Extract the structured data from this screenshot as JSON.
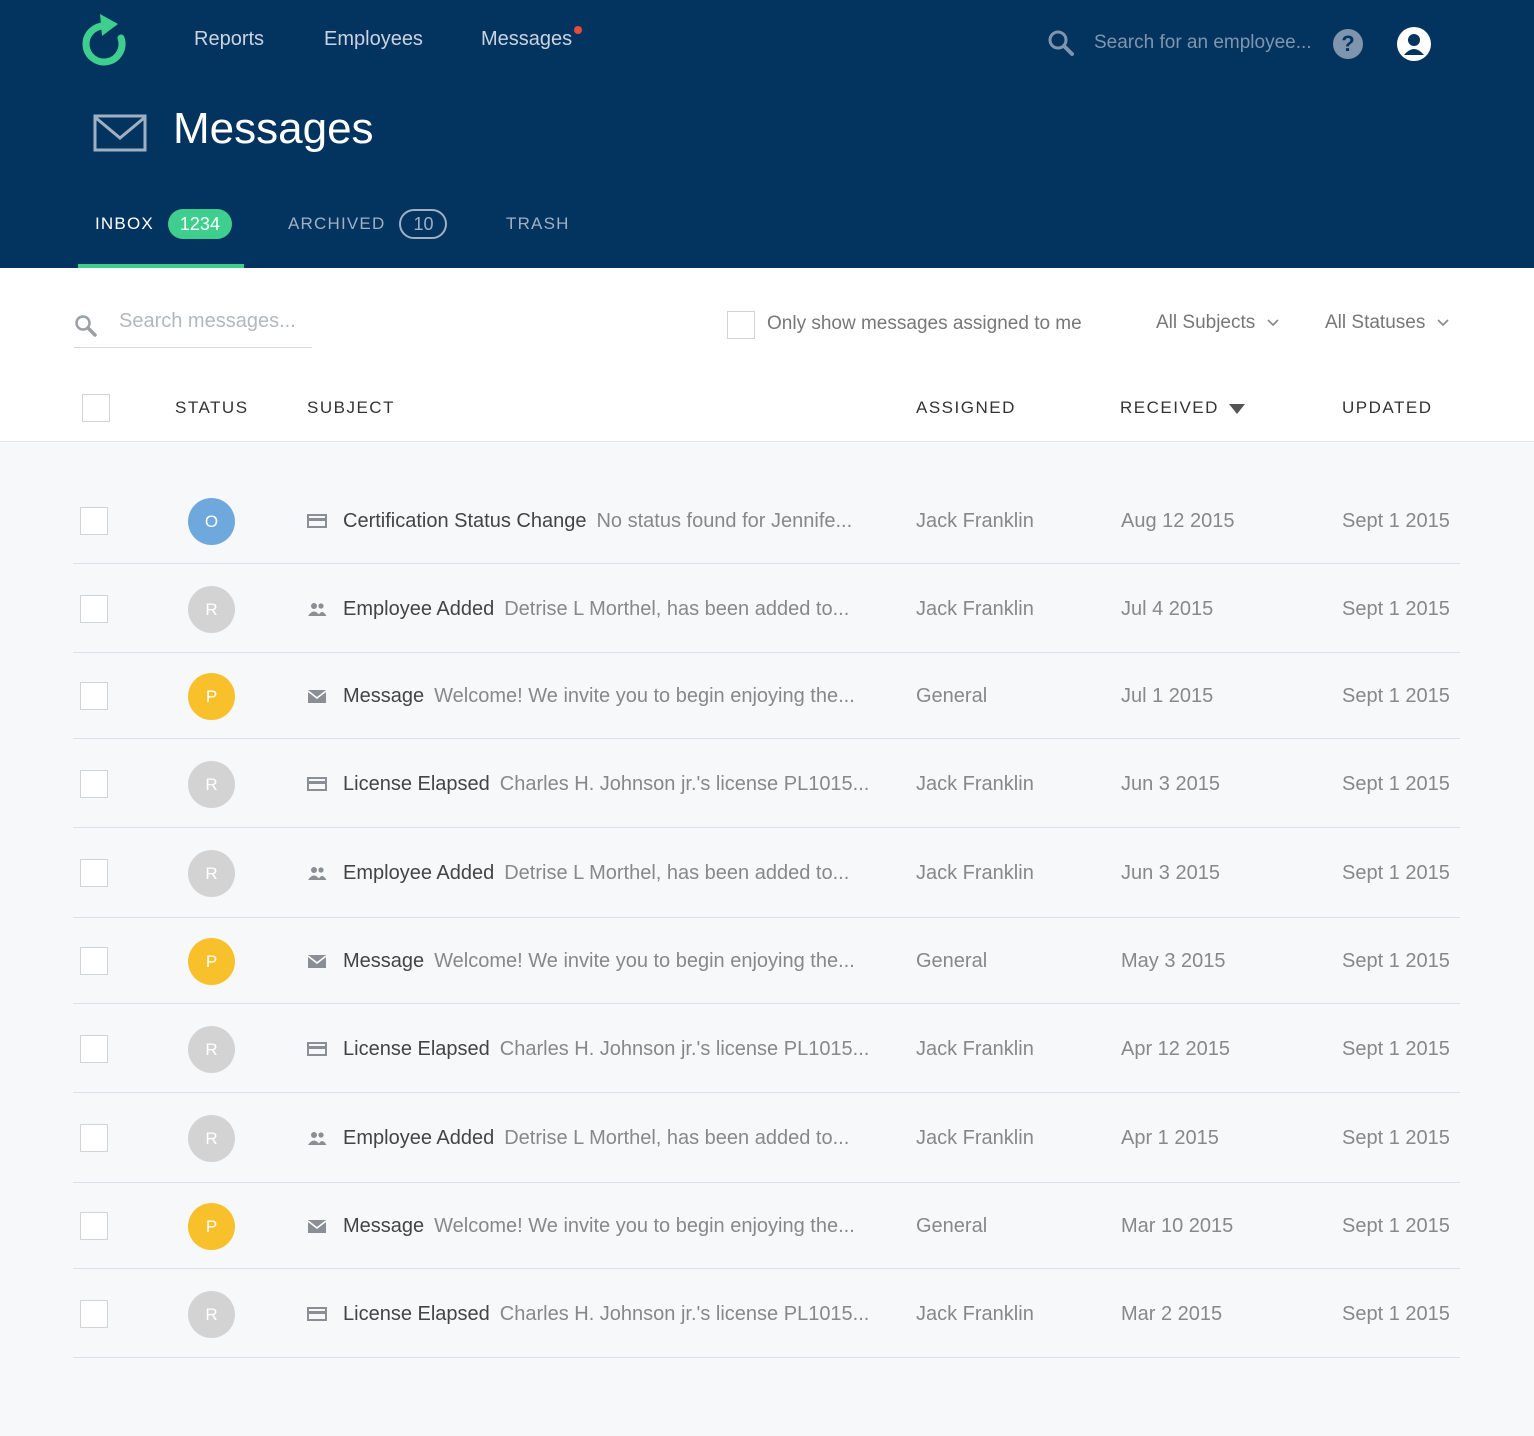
{
  "colors": {
    "header_bg": "#033460",
    "accent_green": "#3ecf8e",
    "status_open": "#6fa8dc",
    "status_pending": "#f8c12b",
    "status_read": "#d3d3d3",
    "notification_dot": "#e74c3c"
  },
  "nav": {
    "items": [
      {
        "label": "Reports"
      },
      {
        "label": "Employees"
      },
      {
        "label": "Messages",
        "has_notification": true
      }
    ],
    "search_placeholder": "Search for an employee...",
    "help_label": "?"
  },
  "page": {
    "title": "Messages",
    "icon": "envelope-icon"
  },
  "tabs": [
    {
      "label": "INBOX",
      "count": "1234",
      "active": true
    },
    {
      "label": "ARCHIVED",
      "count": "10",
      "active": false
    },
    {
      "label": "TRASH",
      "count": "",
      "active": false
    }
  ],
  "filters": {
    "search_placeholder": "Search messages...",
    "assigned_only_label": "Only show messages assigned to me",
    "assigned_only_checked": false,
    "subjects_selected": "All Subjects",
    "statuses_selected": "All Statuses"
  },
  "table": {
    "columns": {
      "status": "STATUS",
      "subject": "SUBJECT",
      "assigned": "ASSIGNED",
      "received": "RECEIVED",
      "updated": "UPDATED"
    },
    "sort_column": "received",
    "sort_direction": "desc",
    "rows": [
      {
        "status": "O",
        "status_kind": "open",
        "icon": "card-icon",
        "subject": "Certification Status Change",
        "preview": "No status found for Jennife...",
        "assigned": "Jack Franklin",
        "received": "Aug 12 2015",
        "updated": "Sept 1 2015"
      },
      {
        "status": "R",
        "status_kind": "read",
        "icon": "people-icon",
        "subject": "Employee Added",
        "preview": "Detrise L Morthel, has been added to...",
        "assigned": "Jack Franklin",
        "received": "Jul 4 2015",
        "updated": "Sept 1 2015"
      },
      {
        "status": "P",
        "status_kind": "pending",
        "icon": "envelope-icon",
        "subject": "Message",
        "preview": "Welcome! We invite you to begin enjoying the...",
        "assigned": "General",
        "received": "Jul 1 2015",
        "updated": "Sept 1 2015"
      },
      {
        "status": "R",
        "status_kind": "read",
        "icon": "card-icon",
        "subject": "License Elapsed",
        "preview": "Charles H. Johnson jr.'s license PL1015...",
        "assigned": "Jack Franklin",
        "received": "Jun 3 2015",
        "updated": "Sept 1 2015"
      },
      {
        "status": "R",
        "status_kind": "read",
        "icon": "people-icon",
        "subject": "Employee Added",
        "preview": "Detrise L Morthel, has been added to...",
        "assigned": "Jack Franklin",
        "received": "Jun 3 2015",
        "updated": "Sept 1 2015"
      },
      {
        "status": "P",
        "status_kind": "pending",
        "icon": "envelope-icon",
        "subject": "Message",
        "preview": "Welcome! We invite you to begin enjoying the...",
        "assigned": "General",
        "received": "May 3 2015",
        "updated": "Sept 1 2015"
      },
      {
        "status": "R",
        "status_kind": "read",
        "icon": "card-icon",
        "subject": "License Elapsed",
        "preview": "Charles H. Johnson jr.'s license PL1015...",
        "assigned": "Jack Franklin",
        "received": "Apr 12 2015",
        "updated": "Sept 1 2015"
      },
      {
        "status": "R",
        "status_kind": "read",
        "icon": "people-icon",
        "subject": "Employee Added",
        "preview": "Detrise L Morthel, has been added to...",
        "assigned": "Jack Franklin",
        "received": "Apr 1 2015",
        "updated": "Sept 1 2015"
      },
      {
        "status": "P",
        "status_kind": "pending",
        "icon": "envelope-icon",
        "subject": "Message",
        "preview": "Welcome! We invite you to begin enjoying the...",
        "assigned": "General",
        "received": "Mar 10 2015",
        "updated": "Sept 1 2015"
      },
      {
        "status": "R",
        "status_kind": "read",
        "icon": "card-icon",
        "subject": "License Elapsed",
        "preview": "Charles H. Johnson jr.'s license PL1015...",
        "assigned": "Jack Franklin",
        "received": "Mar 2 2015",
        "updated": "Sept 1 2015"
      }
    ]
  }
}
